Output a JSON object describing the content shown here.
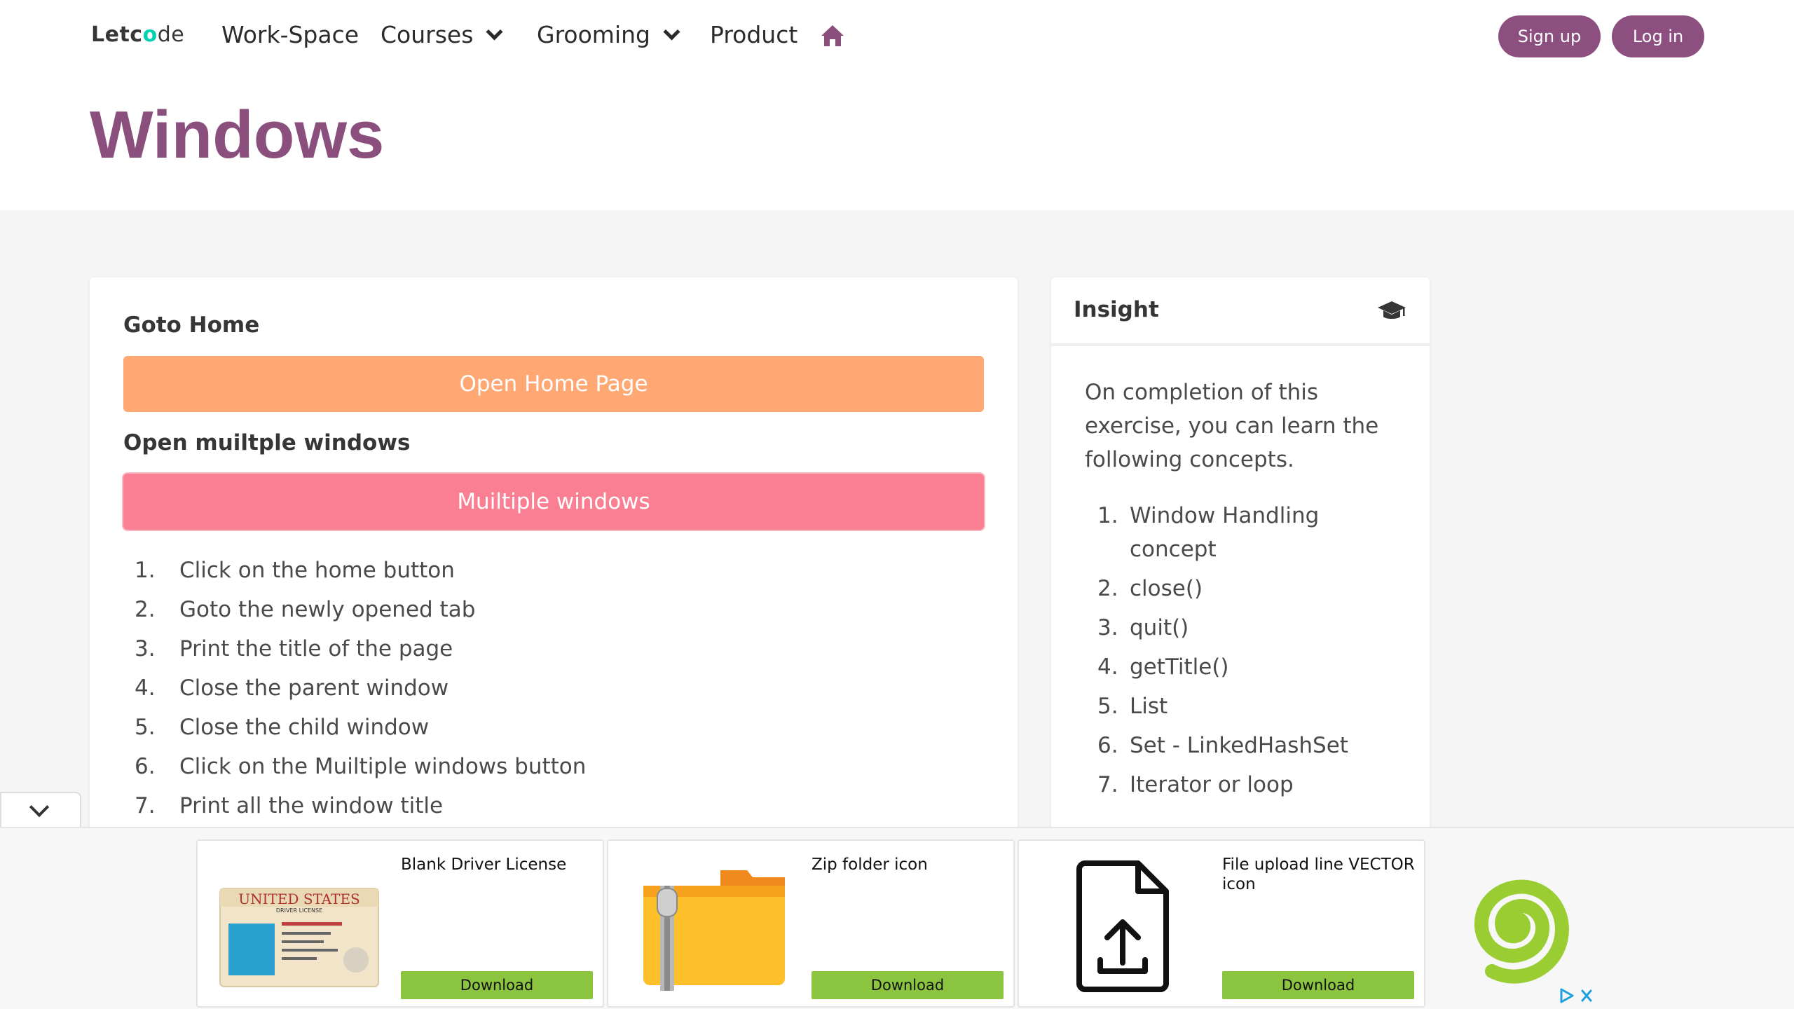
{
  "nav": {
    "brand_prefix": "Letc",
    "brand_o": "o",
    "brand_suffix": "de",
    "workspace": "Work-Space",
    "courses": "Courses",
    "grooming": "Grooming",
    "product": "Product",
    "signup": "Sign up",
    "login": "Log in",
    "home_icon": "home-icon"
  },
  "hero": {
    "title": "Windows"
  },
  "main": {
    "goto_home_label": "Goto Home",
    "open_home_button": "Open Home Page",
    "multi_label": "Open muiltple windows",
    "multi_button": "Muiltiple windows",
    "steps": [
      {
        "num": "1.",
        "text": "Click on the home button"
      },
      {
        "num": "2.",
        "text": "Goto the newly opened tab"
      },
      {
        "num": "3.",
        "text": "Print the title of the page"
      },
      {
        "num": "4.",
        "text": "Close the parent window"
      },
      {
        "num": "5.",
        "text": "Close the child window"
      },
      {
        "num": "6.",
        "text": "Click on the Muiltiple windows button"
      },
      {
        "num": "7.",
        "text": "Print all the window title"
      }
    ]
  },
  "insight": {
    "title": "Insight",
    "icon": "graduation-cap-icon",
    "intro": "On completion of this exercise, you can learn the following concepts.",
    "concepts": [
      {
        "num": "1.",
        "text": "Window Handling concept"
      },
      {
        "num": "2.",
        "text": "close()"
      },
      {
        "num": "3.",
        "text": "quit()"
      },
      {
        "num": "4.",
        "text": "getTitle()"
      },
      {
        "num": "5.",
        "text": "List"
      },
      {
        "num": "6.",
        "text": "Set - LinkedHashSet"
      },
      {
        "num": "7.",
        "text": "Iterator or loop"
      }
    ]
  },
  "ads": [
    {
      "title": "Blank Driver License",
      "button": "Download",
      "card_text": "UNITED STATES",
      "card_sub": "DRIVER LICENSE"
    },
    {
      "title": "Zip folder icon",
      "button": "Download"
    },
    {
      "title": "File upload line VECTOR icon",
      "button": "Download"
    }
  ],
  "colors": {
    "brand_purple": "#8a4f7d",
    "orange_button": "#ffa873",
    "pink_button": "#fa7f92",
    "ad_green": "#8bc53f",
    "brand_teal": "#00d1b2"
  }
}
